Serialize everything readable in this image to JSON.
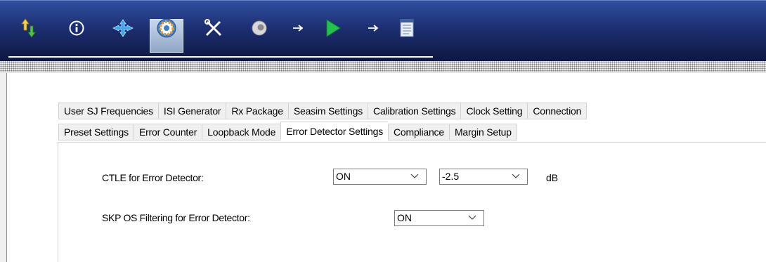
{
  "toolbar": {
    "icons": [
      {
        "name": "up-down-arrows-icon",
        "interactable": true
      },
      {
        "name": "info-icon",
        "interactable": true
      },
      {
        "name": "move-crosshair-icon",
        "interactable": true
      },
      {
        "name": "settings-gear-icon",
        "interactable": true,
        "selected": true
      },
      {
        "name": "tools-icon",
        "interactable": true
      },
      {
        "name": "calibration-disc-icon",
        "interactable": true
      },
      {
        "name": "flow-arrow-icon",
        "interactable": false
      },
      {
        "name": "run-play-icon",
        "interactable": true
      },
      {
        "name": "flow-arrow-icon",
        "interactable": false
      },
      {
        "name": "report-document-icon",
        "interactable": true
      }
    ]
  },
  "tabs": {
    "row1": [
      "User SJ Frequencies",
      "ISI Generator",
      "Rx Package",
      "Seasim Settings",
      "Calibration Settings",
      "Clock Setting",
      "Connection"
    ],
    "row2": [
      "Preset Settings",
      "Error Counter",
      "Loopback Mode",
      "Error Detector Settings",
      "Compliance",
      "Margin Setup"
    ],
    "active": "Error Detector Settings"
  },
  "form": {
    "ctle_label": "CTLE for Error Detector:",
    "ctle_value": "ON",
    "ctle_gain_value": "-2.5",
    "ctle_gain_unit": "dB",
    "skp_label": "SKP OS Filtering for Error Detector:",
    "skp_value": "ON"
  }
}
